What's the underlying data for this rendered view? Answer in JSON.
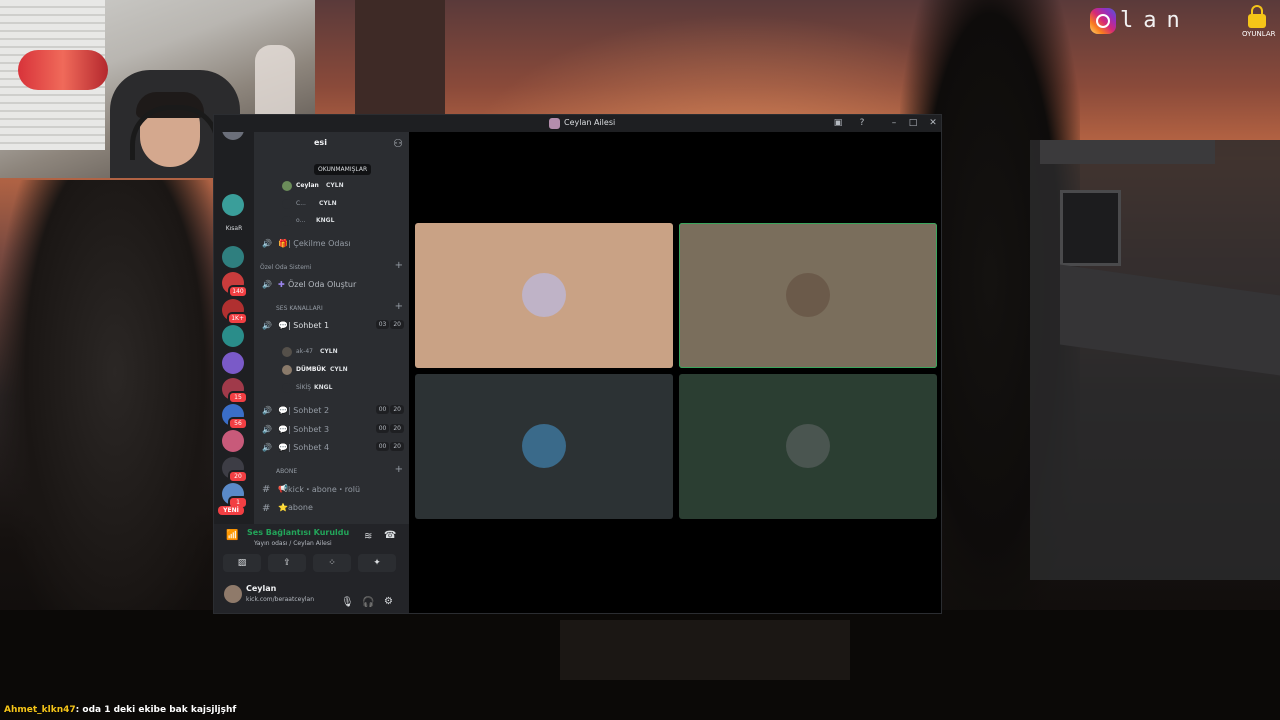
{
  "overlay": {
    "instagram_text": "lan",
    "lock_label": "OYUNLAR"
  },
  "window": {
    "title": "Ceylan Ailesi"
  },
  "server": {
    "name_partial": "esi",
    "tooltip": "OKUNMAMIŞLAR"
  },
  "guilds": [
    {
      "label": "",
      "badge": "",
      "color": "#6b6f7a"
    },
    {
      "label": "",
      "badge": "",
      "color": "#3a9e9a"
    },
    {
      "label": "KısaR",
      "badge": "",
      "color": ""
    },
    {
      "label": "",
      "badge": "",
      "color": "#2f7f7f"
    },
    {
      "label": "",
      "badge": "140",
      "color": "#c83c3c"
    },
    {
      "label": "",
      "badge": "1K+",
      "color": "#b03030"
    },
    {
      "label": "",
      "badge": "",
      "color": "#2a8d8a"
    },
    {
      "label": "",
      "badge": "",
      "color": "#7a5ac8"
    },
    {
      "label": "",
      "badge": "15",
      "color": "#a03a4a"
    },
    {
      "label": "",
      "badge": "56",
      "color": "#3a6ec8"
    },
    {
      "label": "",
      "badge": "",
      "color": "#c85a7a"
    },
    {
      "label": "",
      "badge": "20",
      "color": "#3d3d45"
    },
    {
      "label": "",
      "badge": "1",
      "color": "#5a8ac8"
    }
  ],
  "new_pill": "YENİ",
  "channel_list": {
    "top_members": [
      {
        "name": "Ceylan",
        "tag": "CYLN"
      },
      {
        "name": "C...",
        "tag": "CYLN"
      },
      {
        "name": "o...",
        "tag": "KNGL"
      }
    ],
    "cekilme": "| Çekilme Odası",
    "cat_ozel": "Özel Oda Sistemi",
    "ozel_create": "Özel Oda Oluştur",
    "cat_ses": "SES KANALLARI",
    "sohbet1": {
      "name": "| Sohbet 1",
      "c1": "03",
      "c2": "20"
    },
    "sohbet1_members": [
      {
        "name": "ak-47",
        "tag": "CYLN"
      },
      {
        "name": "DÜMBÜK",
        "tag": "CYLN"
      },
      {
        "name": "SİKİŞ",
        "tag": "KNGL"
      }
    ],
    "sohbet2": {
      "name": "| Sohbet 2",
      "c1": "00",
      "c2": "20"
    },
    "sohbet3": {
      "name": "| Sohbet 3",
      "c1": "00",
      "c2": "20"
    },
    "sohbet4": {
      "name": "| Sohbet 4",
      "c1": "00",
      "c2": "20"
    },
    "cat_abone": "ABONE",
    "kick_abone": "kick・abone・rolü",
    "abone": "abone"
  },
  "voice": {
    "status": "Ses Bağlantısı Kuruldu",
    "subtitle": "Yayın odası / Ceylan Ailesi"
  },
  "user": {
    "name": "Ceylan",
    "status": "kick.com/beraatceylan"
  },
  "stage": {
    "tiles": [
      {
        "bg": "#c9a285",
        "avatar": "#bfb3c7",
        "speaking": false
      },
      {
        "bg": "#7a6e5c",
        "avatar": "#6b5a4a",
        "speaking": true
      },
      {
        "bg": "#2c3234",
        "avatar": "#3a6a8a",
        "speaking": false
      },
      {
        "bg": "#2b3e32",
        "avatar": "#4a5550",
        "speaking": false
      }
    ]
  },
  "chat": {
    "user": "Ahmet_klkn47",
    "message": ": oda 1 deki ekibe bak kajsjljşhf"
  }
}
